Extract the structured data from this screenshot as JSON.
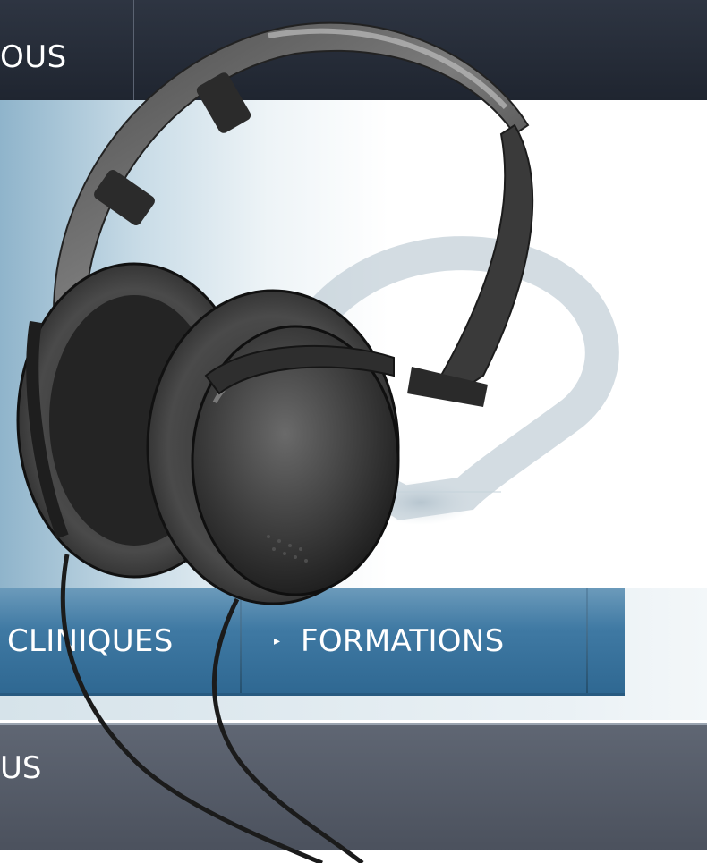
{
  "top_nav": {
    "label": "OUS"
  },
  "sub_nav": {
    "items": [
      {
        "label": "CLINIQUES"
      },
      {
        "label": "FORMATIONS"
      }
    ],
    "arrow_glyph": "▸"
  },
  "lower_bar": {
    "label": "US"
  },
  "hero": {
    "image": "headphones-photo"
  },
  "colors": {
    "top_nav_bg": "#222833",
    "sub_nav_bg": "#3f79a3",
    "lower_bar_bg": "#565c68",
    "text": "#ffffff"
  }
}
